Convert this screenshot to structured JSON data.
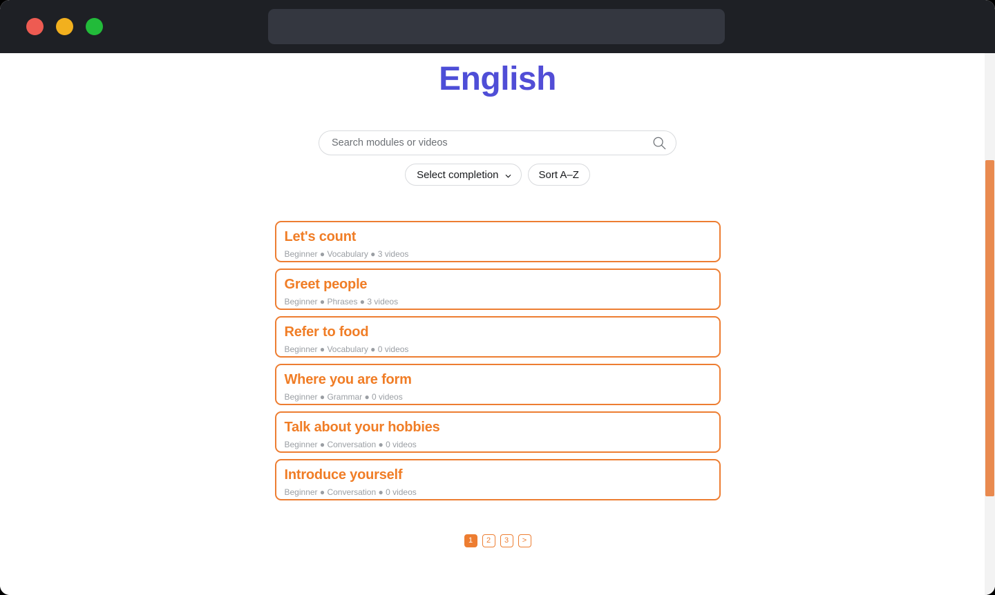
{
  "browser": {
    "traffic_lights": [
      {
        "name": "close",
        "color": "#ee5b52"
      },
      {
        "name": "minimize",
        "color": "#f2b01e"
      },
      {
        "name": "maximize",
        "color": "#22bb3a"
      }
    ],
    "address_bar": {
      "value": "",
      "placeholder": ""
    }
  },
  "page": {
    "title": "English",
    "title_gradient_from": "#3f51d6",
    "title_gradient_to": "#6b46cf"
  },
  "search": {
    "value": "",
    "placeholder": "Search modules or videos",
    "icon": "search-icon"
  },
  "filters": {
    "completion_select": {
      "selected": "Select completion",
      "chevron_icon": "chevron-down-icon"
    },
    "sort_button": "Sort A–Z"
  },
  "modules": [
    {
      "title": "Let's count",
      "level": "Beginner",
      "category": "Vocabulary",
      "videos": "3 videos",
      "meta": "Beginner ● Vocabulary ● 3 videos"
    },
    {
      "title": "Greet people",
      "level": "Beginner",
      "category": "Phrases",
      "videos": "3 videos",
      "meta": "Beginner ● Phrases ● 3 videos"
    },
    {
      "title": "Refer to food",
      "level": "Beginner",
      "category": "Vocabulary",
      "videos": "0 videos",
      "meta": "Beginner ● Vocabulary ● 0 videos"
    },
    {
      "title": "Where you are form",
      "level": "Beginner",
      "category": "Grammar",
      "videos": "0 videos",
      "meta": "Beginner ● Grammar ● 0 videos"
    },
    {
      "title": "Talk about your hobbies",
      "level": "Beginner",
      "category": "Conversation",
      "videos": "0 videos",
      "meta": "Beginner ● Conversation ● 0 videos"
    },
    {
      "title": "Introduce yourself",
      "level": "Beginner",
      "category": "Conversation",
      "videos": "0 videos",
      "meta": "Beginner ● Conversation ● 0 videos"
    }
  ],
  "pagination": {
    "pages": [
      "1",
      "2",
      "3"
    ],
    "current": "1",
    "next_label": ">"
  },
  "colors": {
    "accent_orange": "#ed7d31",
    "title_text": "#f07d26",
    "meta_text": "#9a9ea3",
    "chrome_bg": "#1e2025",
    "address_bg": "#343740",
    "scrollbar_thumb": "#e98a4f"
  }
}
